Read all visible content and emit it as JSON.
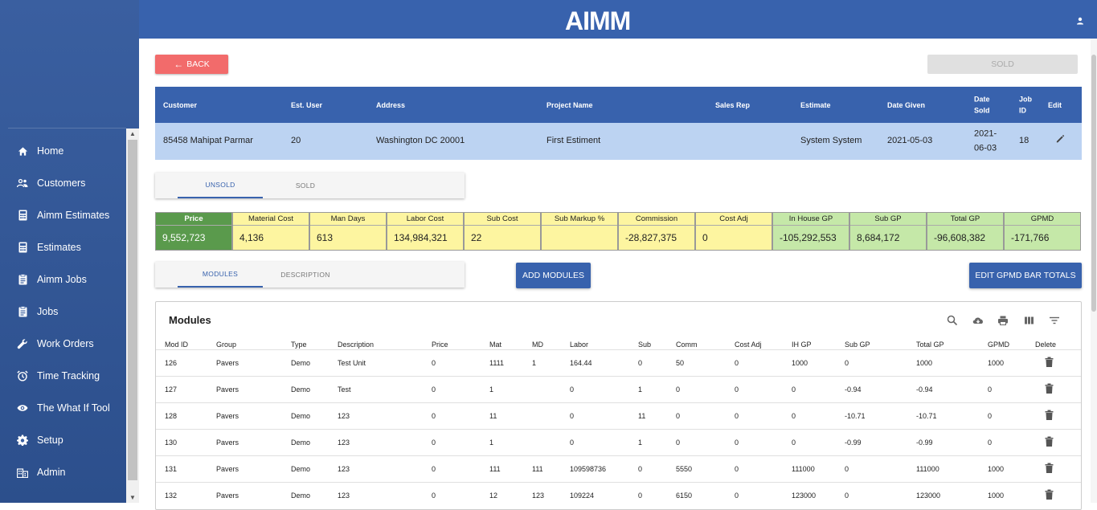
{
  "app": {
    "logo": "AIMM"
  },
  "sidebar": {
    "items": [
      {
        "label": "Home",
        "icon": "home-icon"
      },
      {
        "label": "Customers",
        "icon": "people-icon"
      },
      {
        "label": "Aimm Estimates",
        "icon": "calculator-icon"
      },
      {
        "label": "Estimates",
        "icon": "calculator-icon"
      },
      {
        "label": "Aimm Jobs",
        "icon": "clipboard-icon"
      },
      {
        "label": "Jobs",
        "icon": "clipboard-icon"
      },
      {
        "label": "Work Orders",
        "icon": "wrench-icon"
      },
      {
        "label": "Time Tracking",
        "icon": "alarm-icon"
      },
      {
        "label": "The What If Tool",
        "icon": "eye-icon"
      },
      {
        "label": "Setup",
        "icon": "gear-icon"
      },
      {
        "label": "Admin",
        "icon": "building-icon"
      }
    ]
  },
  "actions": {
    "back": "BACK",
    "sold": "SOLD"
  },
  "info": {
    "headers": [
      "Customer",
      "Est. User",
      "Address",
      "Project Name",
      "Sales Rep",
      "Estimate",
      "Date Given",
      "Date Sold",
      "Job ID",
      "Edit"
    ],
    "header_lines": {
      "date_sold": [
        "Date",
        "Sold"
      ],
      "job_id": [
        "Job",
        "ID"
      ]
    },
    "row": {
      "customer": "85458 Mahipat Parmar",
      "est_user": "20",
      "address": "Washington DC 20001",
      "project_name": "First Estiment",
      "sales_rep": "",
      "estimate": "System System",
      "date_given": "2021-05-03",
      "date_sold_1": "2021-",
      "date_sold_2": "06-03",
      "job_id": "18"
    }
  },
  "status_tabs": {
    "unsold": "UNSOLD",
    "sold": "SOLD"
  },
  "summary": [
    {
      "label": "Price",
      "value": "9,552,723",
      "style": "green-dark"
    },
    {
      "label": "Material Cost",
      "value": "4,136",
      "style": "yellow"
    },
    {
      "label": "Man Days",
      "value": "613",
      "style": "yellow"
    },
    {
      "label": "Labor Cost",
      "value": "134,984,321",
      "style": "yellow"
    },
    {
      "label": "Sub Cost",
      "value": "22",
      "style": "yellow"
    },
    {
      "label": "Sub Markup %",
      "value": "",
      "style": "yellow"
    },
    {
      "label": "Commission",
      "value": "-28,827,375",
      "style": "yellow"
    },
    {
      "label": "Cost Adj",
      "value": "0",
      "style": "yellow"
    },
    {
      "label": "In House GP",
      "value": "-105,292,553",
      "style": "green"
    },
    {
      "label": "Sub GP",
      "value": "8,684,172",
      "style": "green"
    },
    {
      "label": "Total GP",
      "value": "-96,608,382",
      "style": "green"
    },
    {
      "label": "GPMD",
      "value": "-171,766",
      "style": "green"
    }
  ],
  "module_tabs": {
    "modules": "MODULES",
    "description": "DESCRIPTION"
  },
  "buttons": {
    "add_modules": "ADD MODULES",
    "edit_gpmd": "EDIT GPMD BAR TOTALS"
  },
  "modules": {
    "title": "Modules",
    "columns": [
      "Mod ID",
      "Group",
      "Type",
      "Description",
      "Price",
      "Mat",
      "MD",
      "Labor",
      "Sub",
      "Comm",
      "Cost Adj",
      "IH GP",
      "Sub GP",
      "Total GP",
      "GPMD",
      "Delete"
    ],
    "rows": [
      [
        "126",
        "Pavers",
        "Demo",
        "Test Unit",
        "0",
        "1111",
        "1",
        "164.44",
        "0",
        "50",
        "0",
        "1000",
        "0",
        "1000",
        "1000"
      ],
      [
        "127",
        "Pavers",
        "Demo",
        "Test",
        "0",
        "1",
        "",
        "0",
        "1",
        "0",
        "0",
        "0",
        "-0.94",
        "-0.94",
        "0"
      ],
      [
        "128",
        "Pavers",
        "Demo",
        "123",
        "0",
        "11",
        "",
        "0",
        "11",
        "0",
        "0",
        "0",
        "-10.71",
        "-10.71",
        "0"
      ],
      [
        "130",
        "Pavers",
        "Demo",
        "123",
        "0",
        "1",
        "",
        "0",
        "1",
        "0",
        "0",
        "0",
        "-0.99",
        "-0.99",
        "0"
      ],
      [
        "131",
        "Pavers",
        "Demo",
        "123",
        "0",
        "111",
        "111",
        "109598736",
        "0",
        "5550",
        "0",
        "111000",
        "0",
        "111000",
        "1000"
      ],
      [
        "132",
        "Pavers",
        "Demo",
        "123",
        "0",
        "12",
        "123",
        "109224",
        "0",
        "6150",
        "0",
        "123000",
        "0",
        "123000",
        "1000"
      ]
    ]
  }
}
